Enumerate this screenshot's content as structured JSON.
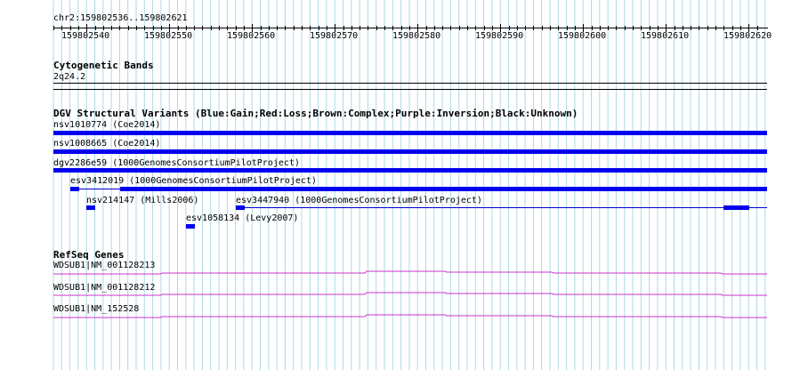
{
  "ruler": {
    "locus": "chr2:159802536..159802621",
    "ticks": [
      "159802540",
      "159802550",
      "159802560",
      "159802570",
      "159802580",
      "159802590",
      "159802600",
      "159802610",
      "159802620"
    ]
  },
  "cytoband": {
    "title": "Cytogenetic Bands",
    "band": "2q24.2"
  },
  "dgv": {
    "title": "DGV Structural Variants (Blue:Gain;Red:Loss;Brown:Complex;Purple:Inversion;Black:Unknown)",
    "items": [
      {
        "label": "nsv1010774 (Coe2014)"
      },
      {
        "label": "nsv1008665 (Coe2014)"
      },
      {
        "label": "dgv2286e59 (1000GenomesConsortiumPilotProject)"
      },
      {
        "label": "esv3412019 (1000GenomesConsortiumPilotProject)"
      },
      {
        "label": "nsv214147 (Mills2006)"
      },
      {
        "label": "esv3447940 (1000GenomesConsortiumPilotProject)"
      },
      {
        "label": "esv1058134 (Levy2007)"
      }
    ],
    "color": "#0000ee"
  },
  "refseq": {
    "title": "RefSeq Genes",
    "genes": [
      {
        "label": "WDSUB1|NM_001128213"
      },
      {
        "label": "WDSUB1|NM_001128212"
      },
      {
        "label": "WDSUB1|NM_152528"
      }
    ],
    "color": "#cc33cc"
  },
  "gridColor": "#add8e6"
}
